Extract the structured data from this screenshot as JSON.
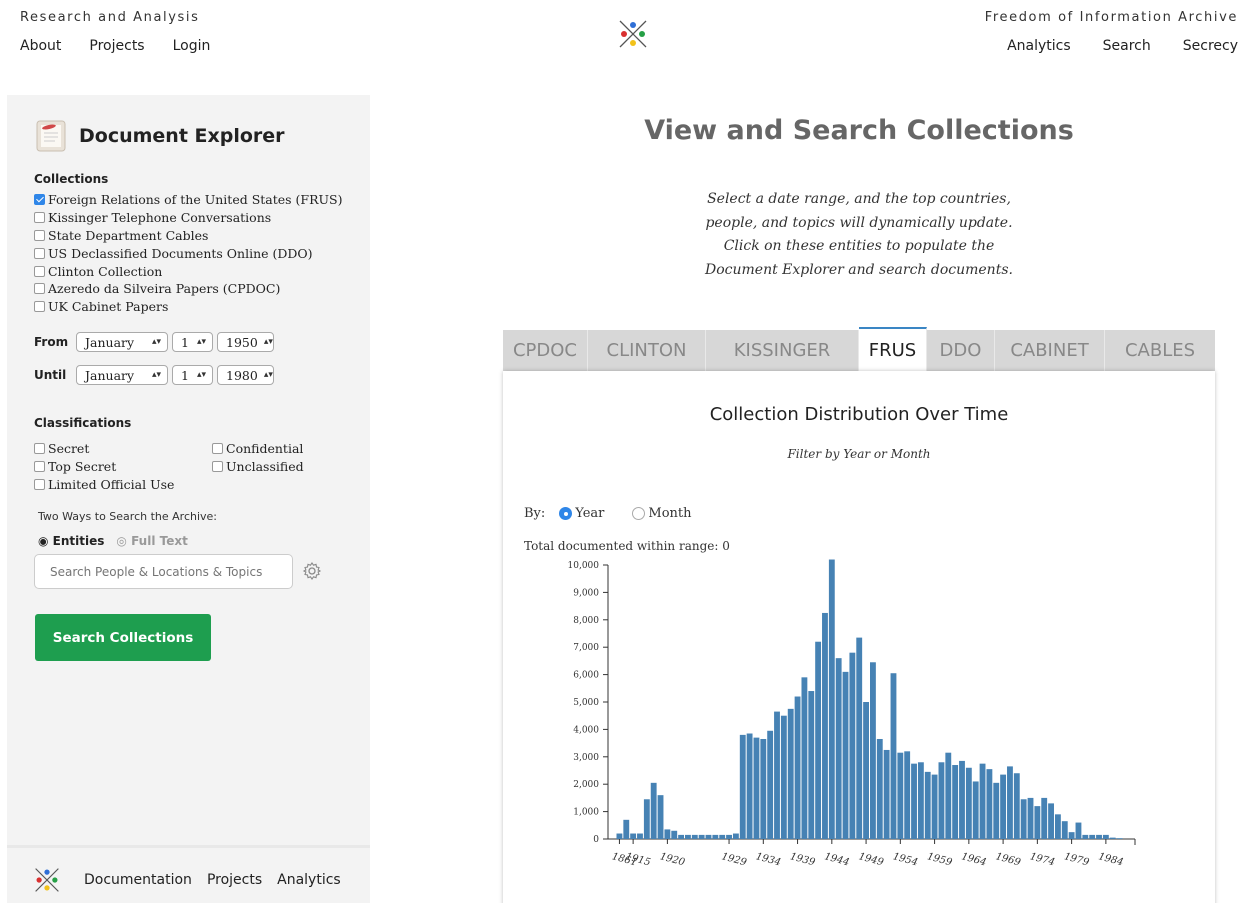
{
  "header": {
    "left_title": "Research and Analysis",
    "left_nav": [
      "About",
      "Projects",
      "Login"
    ],
    "right_title": "Freedom of Information Archive",
    "right_nav": [
      "Analytics",
      "Search",
      "Secrecy"
    ]
  },
  "sidebar": {
    "title": "Document Explorer",
    "collections_label": "Collections",
    "collections": [
      {
        "label": "Foreign Relations of the United States (FRUS)",
        "checked": true
      },
      {
        "label": "Kissinger Telephone Conversations",
        "checked": false
      },
      {
        "label": "State Department Cables",
        "checked": false
      },
      {
        "label": "US Declassified Documents Online (DDO)",
        "checked": false
      },
      {
        "label": "Clinton Collection",
        "checked": false
      },
      {
        "label": "Azeredo da Silveira Papers (CPDOC)",
        "checked": false
      },
      {
        "label": "UK Cabinet Papers",
        "checked": false
      }
    ],
    "from": {
      "label": "From",
      "month": "January",
      "day": "1",
      "year": "1950"
    },
    "until": {
      "label": "Until",
      "month": "January",
      "day": "1",
      "year": "1980"
    },
    "classifications_label": "Classifications",
    "classifications": [
      {
        "label": "Secret",
        "checked": false
      },
      {
        "label": "Confidential",
        "checked": false
      },
      {
        "label": "Top Secret",
        "checked": false
      },
      {
        "label": "Unclassified",
        "checked": false
      },
      {
        "label": "Limited Official Use",
        "checked": false
      }
    ],
    "ways_label": "Two Ways to Search the Archive:",
    "mode_entities": "Entities",
    "mode_fulltext": "Full Text",
    "search_placeholder": "Search People & Locations & Topics",
    "search_button": "Search Collections",
    "footer_links": [
      "Documentation",
      "Projects",
      "Analytics"
    ]
  },
  "main": {
    "title": "View and Search Collections",
    "description": [
      "Select a date range, and the top countries,",
      "people, and topics will dynamically update.",
      "Click on these entities to populate the",
      "Document Explorer and search documents."
    ],
    "tabs": [
      "CPDOC",
      "CLINTON",
      "KISSINGER",
      "FRUS",
      "DDO",
      "CABINET",
      "CABLES"
    ],
    "active_tab": "FRUS",
    "chart_title": "Collection Distribution Over Time",
    "chart_subtitle": "Filter by Year or Month",
    "by_label": "By:",
    "by_year": "Year",
    "by_month": "Month",
    "total_label": "Total documented within range: 0"
  },
  "colors": {
    "accent": "#2f86e8",
    "button": "#1e9e4f",
    "bar": "#4682b4"
  },
  "chart_data": {
    "type": "bar",
    "categories": [
      "1861",
      "1914",
      "1915",
      "1916",
      "1917",
      "1918",
      "1919",
      "1920",
      "1921",
      "1922",
      "1923",
      "1924",
      "1925",
      "1926",
      "1927",
      "1928",
      "1929",
      "1930",
      "1931",
      "1932",
      "1933",
      "1934",
      "1935",
      "1936",
      "1937",
      "1938",
      "1939",
      "1940",
      "1941",
      "1942",
      "1943",
      "1944",
      "1945",
      "1946",
      "1947",
      "1948",
      "1949",
      "1950",
      "1951",
      "1952",
      "1953",
      "1954",
      "1955",
      "1956",
      "1957",
      "1958",
      "1959",
      "1960",
      "1961",
      "1962",
      "1963",
      "1964",
      "1965",
      "1966",
      "1967",
      "1968",
      "1969",
      "1970",
      "1971",
      "1972",
      "1973",
      "1974",
      "1975",
      "1976",
      "1977",
      "1978",
      "1979",
      "1980",
      "1981",
      "1982",
      "1983",
      "1984",
      "1985",
      "1986"
    ],
    "values": [
      200,
      700,
      200,
      200,
      1450,
      2050,
      1600,
      350,
      300,
      150,
      150,
      150,
      150,
      150,
      150,
      150,
      150,
      200,
      3800,
      3850,
      3700,
      3650,
      3950,
      4650,
      4500,
      4750,
      5200,
      5900,
      5400,
      7200,
      8250,
      10200,
      6600,
      6100,
      6800,
      7350,
      5000,
      6450,
      3650,
      3250,
      6050,
      3150,
      3200,
      2750,
      2800,
      2450,
      2350,
      2800,
      3150,
      2700,
      2850,
      2600,
      2100,
      2750,
      2550,
      2050,
      2350,
      2650,
      2400,
      1450,
      1500,
      1200,
      1500,
      1300,
      900,
      650,
      250,
      600,
      150,
      150,
      150,
      150,
      50,
      30
    ],
    "ylim": [
      0,
      10000
    ],
    "yticks": [
      0,
      1000,
      2000,
      3000,
      4000,
      5000,
      6000,
      7000,
      8000,
      9000,
      10000
    ],
    "ytick_labels": [
      "0",
      "1,000",
      "2,000",
      "3,000",
      "4,000",
      "5,000",
      "6,000",
      "7,000",
      "8,000",
      "9,000",
      "10,000"
    ],
    "xtick_labels": [
      "1861",
      "1915",
      "1920",
      "1929",
      "1934",
      "1939",
      "1944",
      "1949",
      "1954",
      "1959",
      "1964",
      "1969",
      "1974",
      "1979",
      "1984"
    ],
    "xtick_categories": [
      "1861",
      "1915",
      "1920",
      "1929",
      "1934",
      "1939",
      "1944",
      "1949",
      "1954",
      "1959",
      "1964",
      "1969",
      "1974",
      "1979",
      "1984"
    ]
  }
}
